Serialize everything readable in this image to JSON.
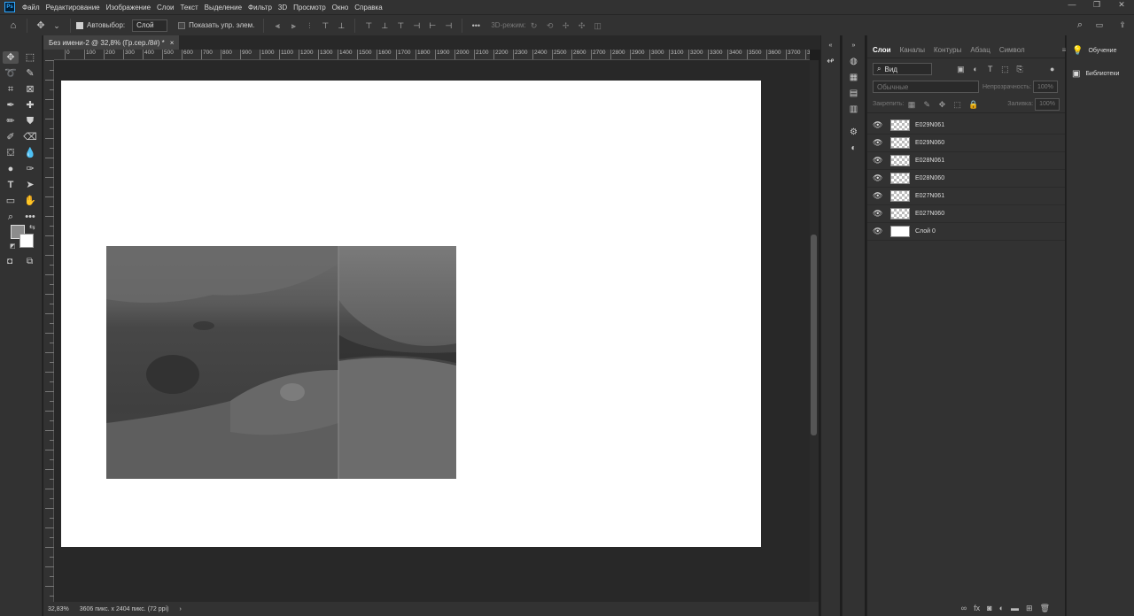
{
  "app": {
    "logo": "Ps"
  },
  "menu": [
    "Файл",
    "Редактирование",
    "Изображение",
    "Слои",
    "Текст",
    "Выделение",
    "Фильтр",
    "3D",
    "Просмотр",
    "Окно",
    "Справка"
  ],
  "window_controls": [
    "—",
    "❐",
    "✕"
  ],
  "options": {
    "autoselect_label": "Автовыбор:",
    "autoselect_value": "Слой",
    "show_transform_label": "Показать упр. элем.",
    "mode_3d_label": "3D-режим:"
  },
  "document": {
    "tab_title": "Без имени-2 @ 32,8% (Гр.сер./8#) *",
    "close": "×"
  },
  "ruler_top": [
    "0",
    "100",
    "200",
    "300",
    "400",
    "500",
    "600",
    "700",
    "800",
    "900",
    "1000",
    "1100",
    "1200",
    "1300",
    "1400",
    "1500",
    "1600",
    "1700",
    "1800",
    "1900",
    "2000",
    "2100",
    "2200",
    "2300",
    "2400",
    "2500",
    "2600",
    "2700",
    "2800",
    "2900",
    "3000",
    "3100",
    "3200",
    "3300",
    "3400",
    "3500",
    "3600",
    "3700",
    "380"
  ],
  "status": {
    "zoom": "32,83%",
    "doc_info": "3606 пикс. x 2404 пикс. (72 ppi)",
    "arrow": "›"
  },
  "layers_panel": {
    "tabs": [
      "Слои",
      "Каналы",
      "Контуры",
      "Абзац",
      "Символ"
    ],
    "filter_kind": "Вид",
    "blend_mode": "Обычные",
    "opacity_label": "Непрозрачность:",
    "opacity_value": "100%",
    "lock_label": "Закрепить:",
    "fill_label": "Заливка:",
    "fill_value": "100%",
    "layers": [
      {
        "name": "E029N061",
        "thumb": "checker"
      },
      {
        "name": "E029N060",
        "thumb": "checker"
      },
      {
        "name": "E028N061",
        "thumb": "checker"
      },
      {
        "name": "E028N060",
        "thumb": "checker"
      },
      {
        "name": "E027N061",
        "thumb": "checker"
      },
      {
        "name": "E027N060",
        "thumb": "checker"
      },
      {
        "name": "Слой 0",
        "thumb": "white"
      }
    ]
  },
  "right_panel": {
    "items": [
      {
        "label": "Обучение",
        "icon": "lightbulb-icon"
      },
      {
        "label": "Библиотеки",
        "icon": "libraries-icon"
      }
    ]
  },
  "colors": {
    "foreground": "#8c8c8c",
    "background": "#ffffff",
    "ui_dark": "#323232"
  }
}
